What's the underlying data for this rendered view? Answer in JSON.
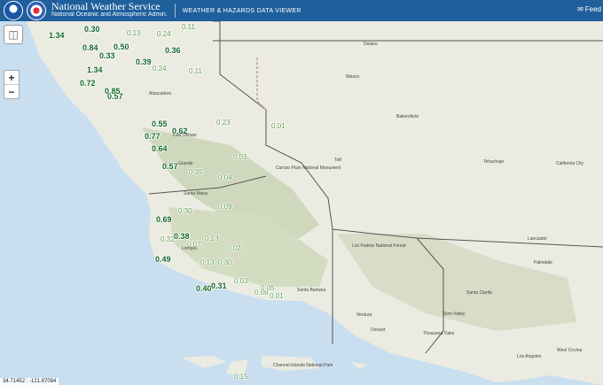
{
  "header": {
    "org_name": "National Weather Service",
    "org_sub": "National Oceanic and Atmospheric Admin.",
    "app_title": "WEATHER & HAZARDS DATA VIEWER",
    "feedback_label": "Feed"
  },
  "controls": {
    "zoom_in": "+",
    "zoom_out": "−"
  },
  "coords": "34.71452 : -121.87084",
  "observations": [
    {
      "v": "1.34",
      "d": 1
    },
    {
      "v": "0.30",
      "d": 1
    },
    {
      "v": "0.13",
      "d": 0
    },
    {
      "v": "0.24",
      "d": 0
    },
    {
      "v": "0.11",
      "d": 0
    },
    {
      "v": "0.84",
      "d": 1
    },
    {
      "v": "0.50",
      "d": 1
    },
    {
      "v": "0.33",
      "d": 1
    },
    {
      "v": "0.36",
      "d": 1
    },
    {
      "v": "0.39",
      "d": 1
    },
    {
      "v": "0.24",
      "d": 0
    },
    {
      "v": "0.11",
      "d": 0
    },
    {
      "v": "1.34",
      "d": 1
    },
    {
      "v": "0.72",
      "d": 1
    },
    {
      "v": "0.57",
      "d": 1
    },
    {
      "v": "0.85",
      "d": 1
    },
    {
      "v": "0.55",
      "d": 1
    },
    {
      "v": "0.77",
      "d": 1
    },
    {
      "v": "0.62",
      "d": 1
    },
    {
      "v": "0.23",
      "d": 0
    },
    {
      "v": "0.01",
      "d": 0
    },
    {
      "v": "0.64",
      "d": 1
    },
    {
      "v": "0.03",
      "d": 0
    },
    {
      "v": "0.57",
      "d": 1
    },
    {
      "v": "0.35",
      "d": 0
    },
    {
      "v": "0.04",
      "d": 0
    },
    {
      "v": "0.09",
      "d": 0
    },
    {
      "v": "0.69",
      "d": 1
    },
    {
      "v": "0.30",
      "d": 0
    },
    {
      "v": "0.32",
      "d": 0
    },
    {
      "v": "0.38",
      "d": 1
    },
    {
      "v": "0.07",
      "d": 0
    },
    {
      "v": "0.13",
      "d": 0
    },
    {
      "v": "0.02",
      "d": 0
    },
    {
      "v": "0.49",
      "d": 1
    },
    {
      "v": "0.13",
      "d": 0
    },
    {
      "v": "0.30",
      "d": 0
    },
    {
      "v": "0.40",
      "d": 1
    },
    {
      "v": "0.31",
      "d": 1
    },
    {
      "v": "0.03",
      "d": 0
    },
    {
      "v": "0.06",
      "d": 0
    },
    {
      "v": "0.05",
      "d": 0
    },
    {
      "v": "0.01",
      "d": 0
    },
    {
      "v": "0.15",
      "d": 0
    }
  ],
  "places": [
    "Atascadero",
    "Luis Obispo",
    "Grande",
    "Santa Maria",
    "Lompoc",
    "Santa Barbara",
    "Ventura",
    "Oxnard",
    "Thousand Oaks",
    "Simi Valley",
    "Santa Clarita",
    "Palmdale",
    "Lancaster",
    "Los Angeles",
    "West Covina",
    "Bakersfield",
    "Tehachapi",
    "California City",
    "Taft",
    "Delano",
    "Wasco",
    "Los Padres National Forest",
    "Carrizo Plain National Monument",
    "Channel Islands National Park"
  ]
}
